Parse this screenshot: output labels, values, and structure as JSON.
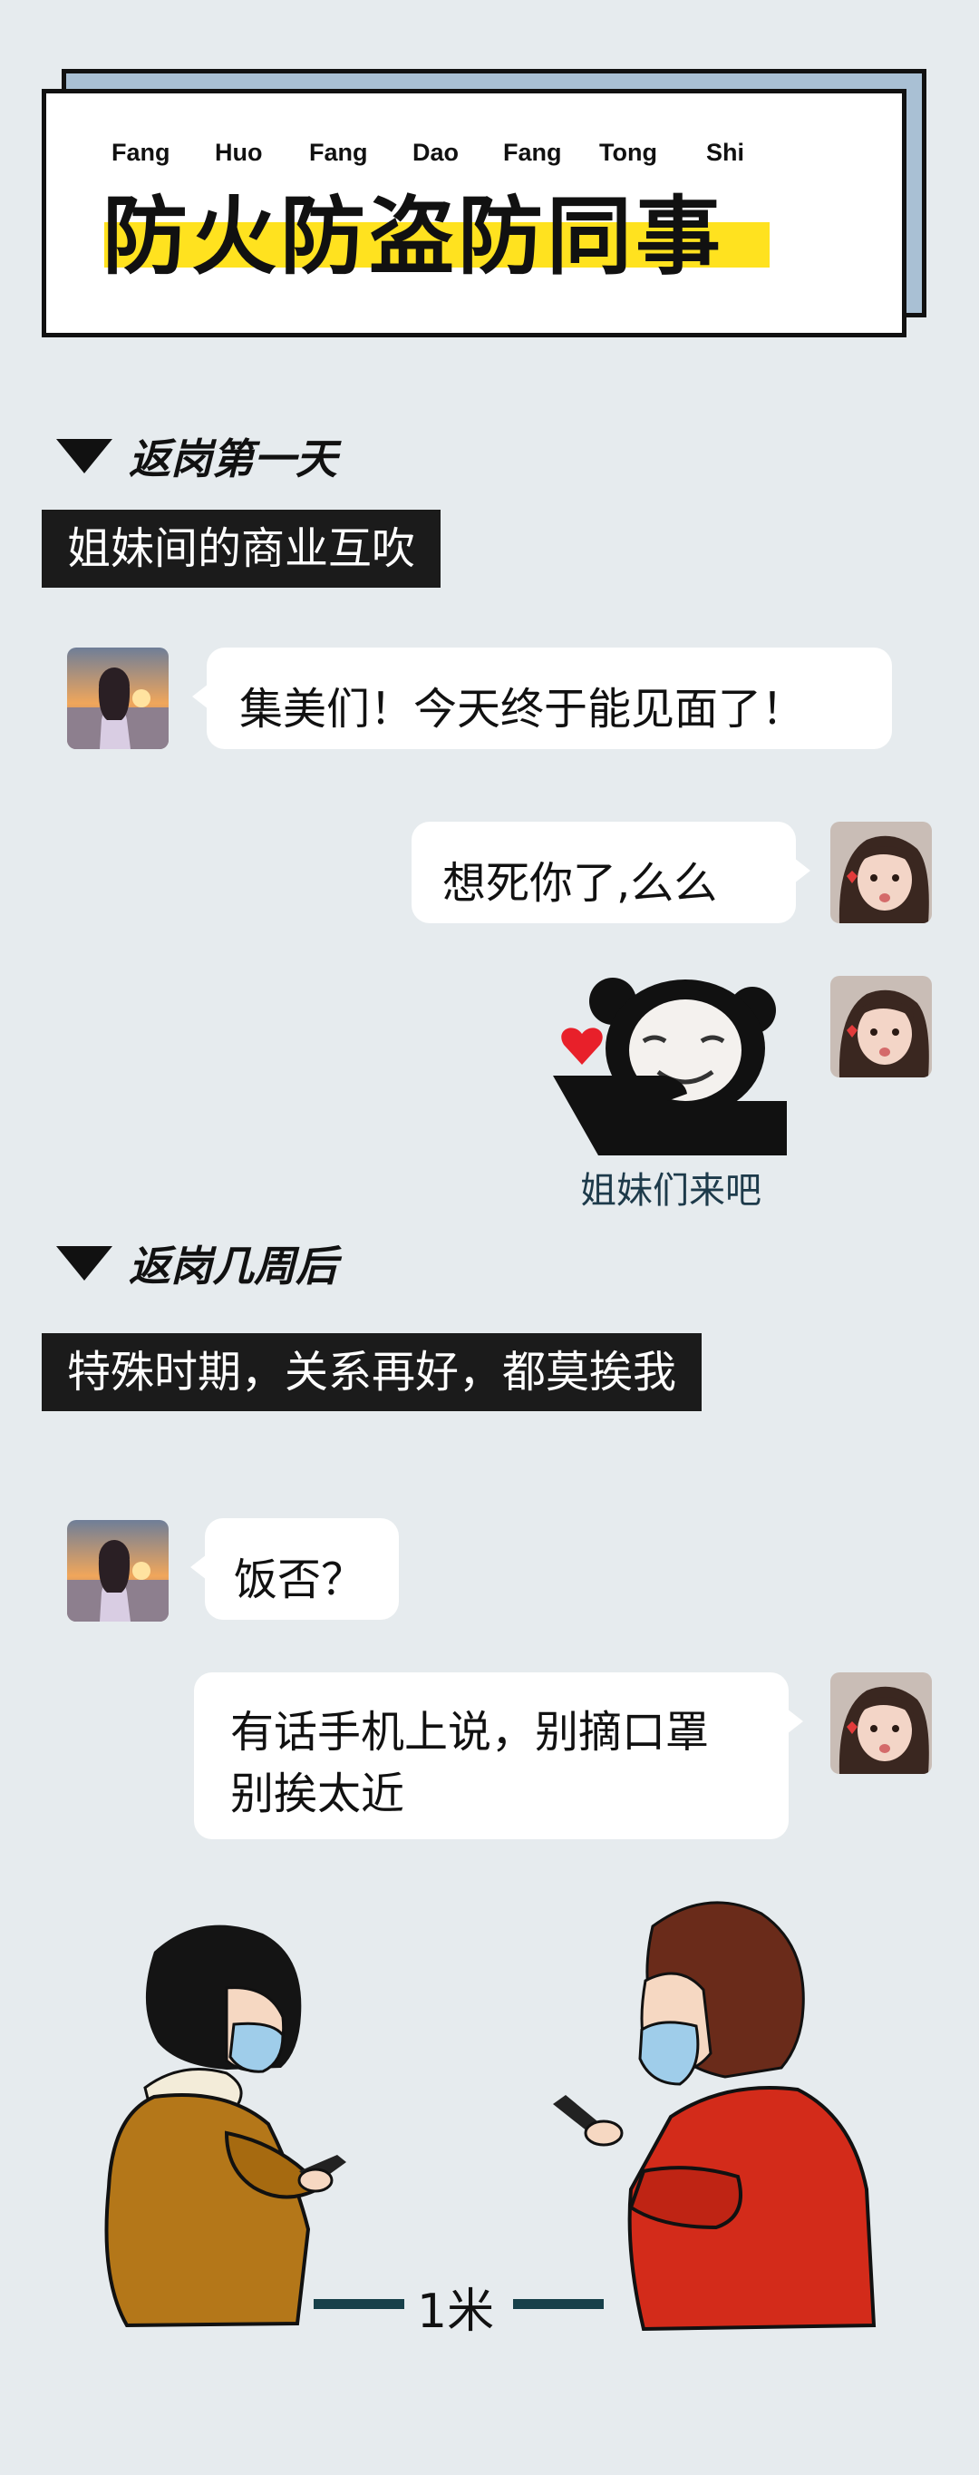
{
  "header": {
    "pinyin": [
      "Fang",
      "Huo",
      "Fang",
      "Dao",
      "Fang",
      "Tong",
      "Shi"
    ],
    "title": "防火防盗防同事",
    "colors": {
      "highlight": "#ffe21f",
      "shadow_card": "#a9c0d4",
      "background": "#e6ebee"
    }
  },
  "section1": {
    "heading": "返岗第一天",
    "banner": "姐妹间的商业互吹",
    "messages": [
      {
        "side": "left",
        "avatar": "sunset-girl-avatar",
        "text": "集美们！今天终于能见面了！"
      },
      {
        "side": "right",
        "avatar": "little-girl-avatar",
        "text": "想死你了,么么"
      },
      {
        "side": "right",
        "avatar": "little-girl-avatar",
        "sticker": "panda-meme-heart-sticker",
        "caption": "姐妹们来吧"
      }
    ]
  },
  "section2": {
    "heading": "返岗几周后",
    "banner": "特殊时期，关系再好，都莫挨我",
    "messages": [
      {
        "side": "left",
        "avatar": "sunset-girl-avatar",
        "text": "饭否？"
      },
      {
        "side": "right",
        "avatar": "little-girl-avatar",
        "text_line1": "有话手机上说，别摘口罩",
        "text_line2": "别挨太近"
      }
    ]
  },
  "illustration": {
    "left_person": "woman-in-brown-coat-with-mask",
    "right_person": "woman-in-red-coat-with-mask",
    "distance_label": "1米"
  }
}
